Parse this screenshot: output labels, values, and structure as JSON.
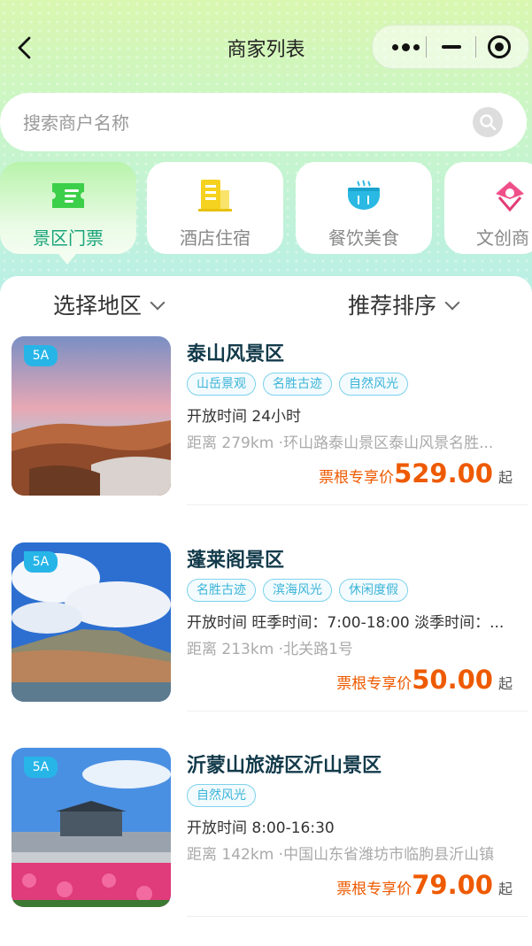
{
  "nav": {
    "title": "商家列表"
  },
  "search": {
    "placeholder": "搜索商户名称"
  },
  "categories": [
    {
      "label": "景区门票",
      "icon": "ticket-icon",
      "active": true
    },
    {
      "label": "酒店住宿",
      "icon": "hotel-icon",
      "active": false
    },
    {
      "label": "餐饮美食",
      "icon": "food-bowl-icon",
      "active": false
    },
    {
      "label": "文创商",
      "icon": "kite-icon",
      "active": false
    }
  ],
  "filters": {
    "region": "选择地区",
    "sort": "推荐排序"
  },
  "merchants": [
    {
      "badge": "5A",
      "name": "泰山风景区",
      "tags": [
        "山岳景观",
        "名胜古迹",
        "自然风光"
      ],
      "open": "开放时间 24小时",
      "distance": "距离 279km ·环山路泰山景区泰山风景名胜...",
      "price_label": "票根专享价",
      "price": "529.00",
      "price_suffix": "起"
    },
    {
      "badge": "5A",
      "name": "蓬莱阁景区",
      "tags": [
        "名胜古迹",
        "滨海风光",
        "休闲度假"
      ],
      "open": "开放时间 旺季时间：7:00-18:00 淡季时间：...",
      "distance": "距离 213km ·北关路1号",
      "price_label": "票根专享价",
      "price": "50.00",
      "price_suffix": "起"
    },
    {
      "badge": "5A",
      "name": "沂蒙山旅游区沂山景区",
      "tags": [
        "自然风光"
      ],
      "open": "开放时间 8:00-16:30",
      "distance": "距离 142km ·中国山东省潍坊市临朐县沂山镇",
      "price_label": "票根专享价",
      "price": "79.00",
      "price_suffix": "起"
    }
  ],
  "colors": {
    "accent": "#19a37a",
    "price": "#ee5a00",
    "tag": "#3bb4d8",
    "badge": "#27b5e8"
  }
}
